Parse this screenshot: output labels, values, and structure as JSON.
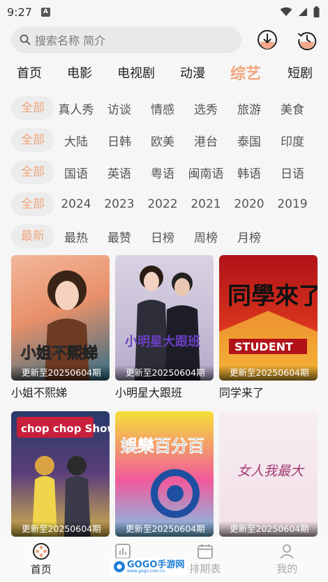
{
  "status": {
    "time": "9:27",
    "sim_label": "A"
  },
  "search": {
    "placeholder": "搜索名称 简介"
  },
  "nav": {
    "tabs": [
      "首页",
      "电影",
      "电视剧",
      "动漫",
      "综艺",
      "短剧"
    ],
    "active": "综艺"
  },
  "filters": {
    "genre": [
      "全部",
      "真人秀",
      "访谈",
      "情感",
      "选秀",
      "旅游",
      "美食"
    ],
    "region": [
      "全部",
      "大陆",
      "日韩",
      "欧美",
      "港台",
      "泰国",
      "印度"
    ],
    "language": [
      "全部",
      "国语",
      "英语",
      "粤语",
      "闽南语",
      "韩语",
      "日语"
    ],
    "year": [
      "全部",
      "2024",
      "2023",
      "2022",
      "2021",
      "2020",
      "2019"
    ],
    "sort": [
      "最新",
      "最热",
      "最赞",
      "日榜",
      "周榜",
      "月榜"
    ]
  },
  "shows": [
    {
      "title": "小姐不熙娣",
      "badge": "更新至20250604期",
      "poster_text": "小姐不熙娣"
    },
    {
      "title": "小明星大跟班",
      "badge": "更新至20250604期",
      "poster_text": "小明星大跟班"
    },
    {
      "title": "同学来了",
      "badge": "更新至20250604期",
      "poster_text": "同學來了"
    },
    {
      "title": "",
      "badge": "更新至20250604期",
      "poster_text": "chop chop Show"
    },
    {
      "title": "",
      "badge": "更新至20250604期",
      "poster_text": "娛樂百分百"
    },
    {
      "title": "",
      "badge": "更新至20250604期",
      "poster_text": "女人我最大"
    }
  ],
  "tabbar": {
    "items": [
      "首页",
      "排行",
      "排期表",
      "我的"
    ],
    "active": "首页"
  },
  "watermark": {
    "text": "GOGO手游网",
    "sub": "www.gogo.com.cn"
  },
  "colors": {
    "accent": "#f0a57d",
    "background": "#f6f6f6"
  }
}
